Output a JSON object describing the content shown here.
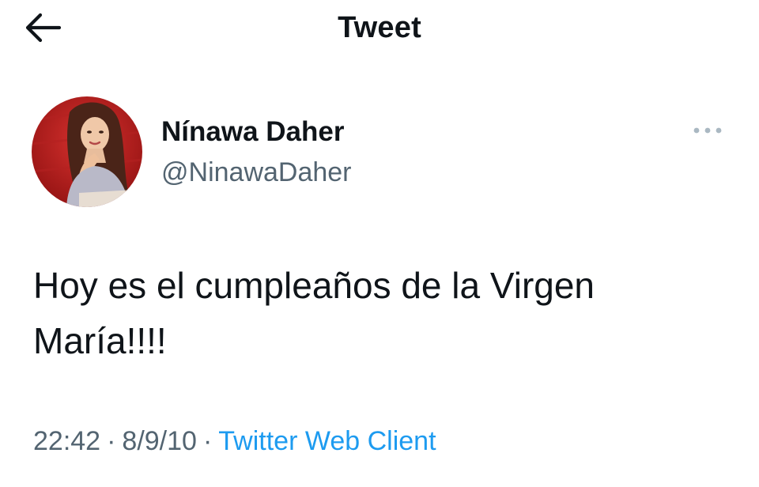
{
  "header": {
    "back_icon": "arrow-left-icon",
    "title": "Tweet"
  },
  "tweet": {
    "author": {
      "name": "Nínawa Daher",
      "handle": "@NinawaDaher",
      "avatar": "profile-photo"
    },
    "more_icon": "more-horizontal-icon",
    "text": "Hoy es el cumpleaños de la Virgen María!!!!",
    "time": "22:42",
    "date": "8/9/10",
    "separator": "·",
    "source": "Twitter Web Client"
  },
  "colors": {
    "text_primary": "#0f1419",
    "text_secondary": "#536471",
    "link": "#1d9bf0",
    "background": "#ffffff"
  }
}
